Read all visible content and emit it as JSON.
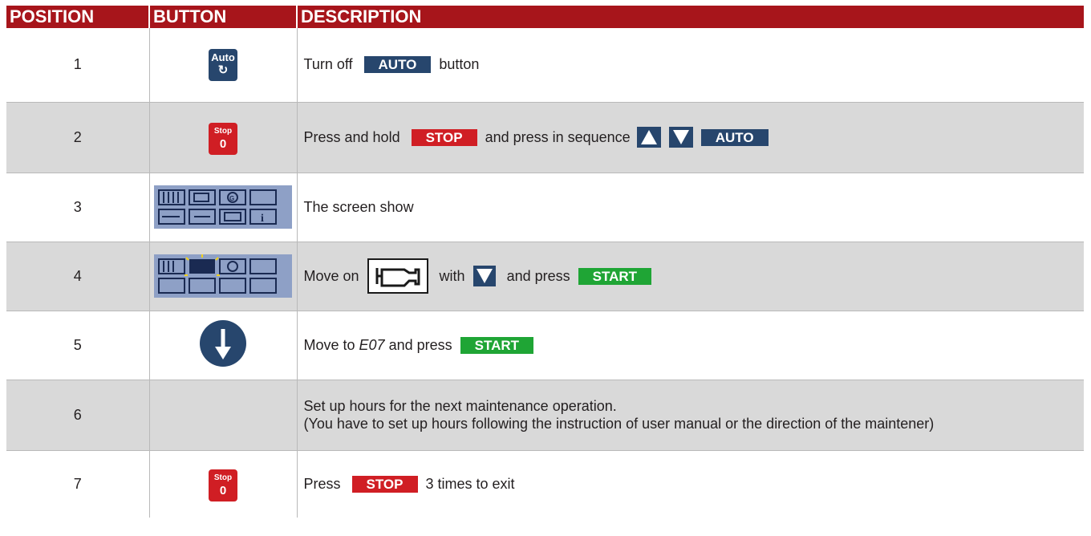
{
  "headers": {
    "position": "POSITION",
    "button": "BUTTON",
    "description": "DESCRIPTION"
  },
  "keys": {
    "auto_label": "Auto",
    "auto_symbol": "↻",
    "stop_label": "Stop",
    "stop_symbol": "0"
  },
  "rows": [
    {
      "position": "1",
      "desc_a": "Turn off",
      "label_a": "AUTO",
      "desc_b": "button"
    },
    {
      "position": "2",
      "desc_a": "Press and hold",
      "label_a": "STOP",
      "desc_b": "and press in sequence",
      "label_b": "AUTO"
    },
    {
      "position": "3",
      "desc_a": "The screen show"
    },
    {
      "position": "4",
      "desc_a": "Move on",
      "desc_b": "with",
      "desc_c": "and press",
      "label_a": "START"
    },
    {
      "position": "5",
      "desc_a": "Move to",
      "desc_em": "E07",
      "desc_b": "and press",
      "label_a": "START"
    },
    {
      "position": "6",
      "line1": "Set up hours for the next maintenance operation.",
      "line2": "(You have to set up hours following the instruction of user manual or the direction of the maintener)"
    },
    {
      "position": "7",
      "desc_a": "Press",
      "label_a": "STOP",
      "desc_b": "3 times to exit"
    }
  ],
  "colors": {
    "header": "#a7151b",
    "auto": "#27466d",
    "stop": "#d01e24",
    "start": "#1fa535",
    "alt_row": "#d9d9d9",
    "screen": "#8ea0c6"
  },
  "icons": {
    "up": "triangle-up-icon",
    "down": "triangle-down-icon",
    "engine": "engine-icon",
    "arrow": "down-arrow-circle-icon"
  }
}
